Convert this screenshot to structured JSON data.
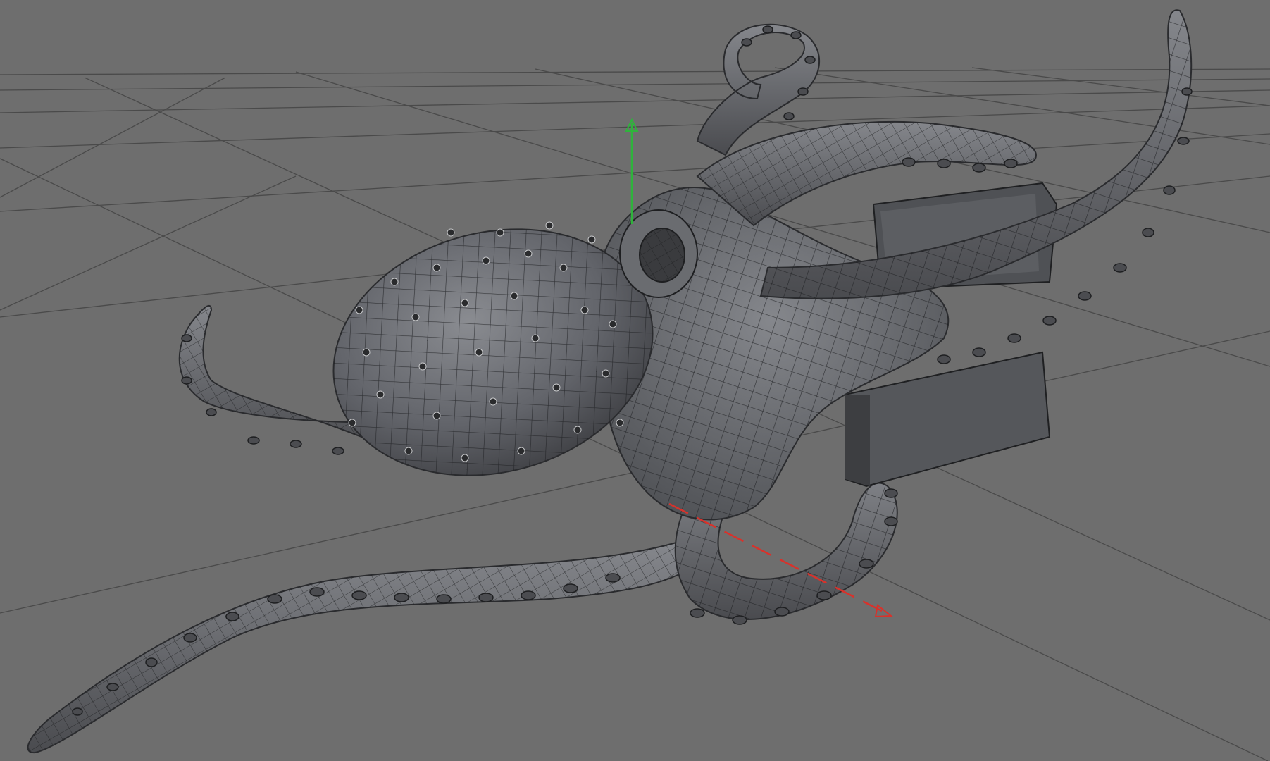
{
  "viewport": {
    "background": "#6e6e6e",
    "grid_color": "#4a4a4a",
    "model_color": "#5f6166",
    "wire_color": "#1c1d1f",
    "x_axis_color": "#d8322b",
    "y_axis_color": "#2fb33c"
  }
}
